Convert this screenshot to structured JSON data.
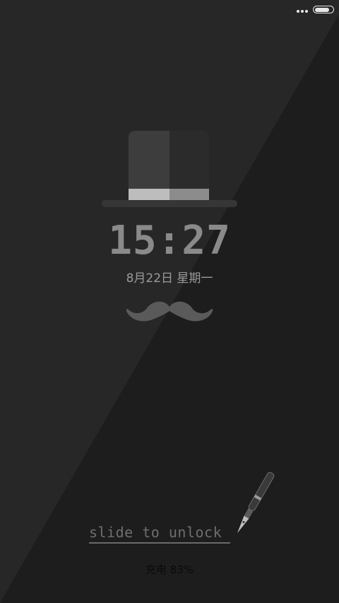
{
  "lockscreen": {
    "time": "15:27",
    "date": "8月22日 星期一",
    "unlock_hint": "slide to unlock",
    "charging_status": "充电 83%"
  },
  "status_bar": {
    "battery_level": 0.83,
    "icons": [
      "more-dots-icon",
      "battery-icon"
    ]
  },
  "theme": {
    "background": "#1e1e1e",
    "clock_color": "#8a8a8a",
    "text_color": "#9a9a9a"
  }
}
